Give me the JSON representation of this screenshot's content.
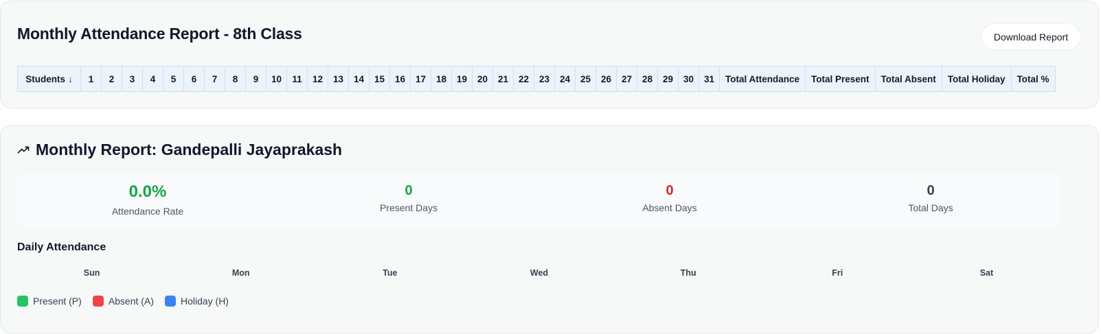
{
  "attendance_report": {
    "title": "Monthly Attendance Report - 8th Class",
    "download_label": "Download Report",
    "table": {
      "students_header": "Students",
      "sort_icon": "arrow-down-icon",
      "days": [
        "1",
        "2",
        "3",
        "4",
        "5",
        "6",
        "7",
        "8",
        "9",
        "10",
        "11",
        "12",
        "13",
        "14",
        "15",
        "16",
        "17",
        "18",
        "19",
        "20",
        "21",
        "22",
        "23",
        "24",
        "25",
        "26",
        "27",
        "28",
        "29",
        "30",
        "31"
      ],
      "summary_headers": [
        "Total Attendance",
        "Total Present",
        "Total Absent",
        "Total Holiday",
        "Total %"
      ]
    }
  },
  "student_report": {
    "title_icon": "trending-up-icon",
    "title": "Monthly Report: Gandepalli Jayaprakash",
    "stats": [
      {
        "key": "rate",
        "value": "0.0%",
        "label": "Attendance Rate"
      },
      {
        "key": "present",
        "value": "0",
        "label": "Present Days"
      },
      {
        "key": "absent",
        "value": "0",
        "label": "Absent Days"
      },
      {
        "key": "total",
        "value": "0",
        "label": "Total Days"
      }
    ],
    "daily_title": "Daily Attendance",
    "weekdays": [
      "Sun",
      "Mon",
      "Tue",
      "Wed",
      "Thu",
      "Fri",
      "Sat"
    ],
    "legend": [
      {
        "label": "Present (P)",
        "color": "#22c55e"
      },
      {
        "label": "Absent (A)",
        "color": "#ef4444"
      },
      {
        "label": "Holiday (H)",
        "color": "#3b82f6"
      }
    ]
  }
}
